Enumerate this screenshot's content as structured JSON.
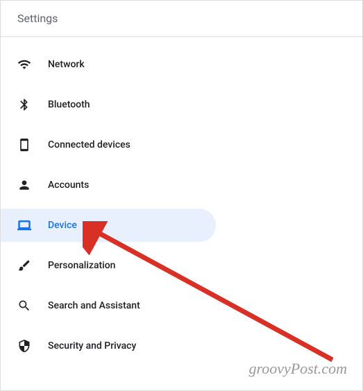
{
  "header": {
    "title": "Settings"
  },
  "sidebar": {
    "items": [
      {
        "label": "Network",
        "icon": "wifi-icon",
        "active": false
      },
      {
        "label": "Bluetooth",
        "icon": "bluetooth-icon",
        "active": false
      },
      {
        "label": "Connected devices",
        "icon": "connected-devices-icon",
        "active": false
      },
      {
        "label": "Accounts",
        "icon": "person-icon",
        "active": false
      },
      {
        "label": "Device",
        "icon": "laptop-icon",
        "active": true
      },
      {
        "label": "Personalization",
        "icon": "brush-icon",
        "active": false
      },
      {
        "label": "Search and Assistant",
        "icon": "search-icon",
        "active": false
      },
      {
        "label": "Security and Privacy",
        "icon": "shield-icon",
        "active": false
      }
    ]
  },
  "watermark": "groovyPost.com"
}
